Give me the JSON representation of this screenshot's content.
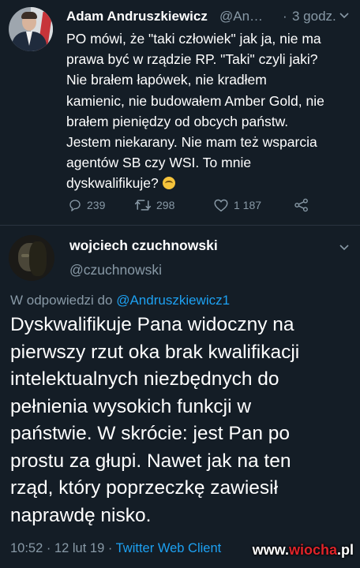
{
  "tweet1": {
    "author_name": "Adam Andruszkiewicz",
    "author_handle": "@An…",
    "separator": "·",
    "time": "3 godz.",
    "text_lines": [
      "PO mówi, że \"taki człowiek\" jak ja, nie ma",
      "prawa być w rządzie RP. \"Taki\" czyli jaki?",
      "Nie brałem łapówek, nie kradłem",
      "kamienic, nie budowałem Amber Gold, nie",
      "brałem pieniędzy od obcych państw.",
      "Jestem niekarany. Nie mam też wsparcia",
      "agentów SB czy WSI. To mnie",
      "dyskwalifikuje?"
    ],
    "emoji": "upside-down-face-emoji",
    "replies": "239",
    "retweets": "298",
    "likes": "1 187"
  },
  "tweet2": {
    "author_name": "wojciech czuchnowski",
    "author_handle": "@czuchnowski",
    "reply_prefix": "W odpowiedzi do",
    "reply_mention": "@Andruszkiewicz1",
    "text_lines": [
      "Dyskwalifikuje Pana widoczny na",
      "pierwszy rzut oka  brak kwalifikacji",
      "intelektualnych niezbędnych do",
      "pełnienia wysokich funkcji w",
      "państwie. W skrócie: jest Pan po",
      "prostu za głupi. Nawet jak na ten",
      "rząd, który poprzeczkę zawiesił",
      "naprawdę nisko."
    ],
    "meta_time": "10:52 · 12 lut 19 ·",
    "meta_client": "Twitter Web Client"
  },
  "watermark": {
    "prefix": "www.",
    "brand": "wiocha",
    "suffix": ".pl"
  },
  "colors": {
    "background": "#141d26",
    "secondary_text": "#8899a6",
    "link": "#1da1f2",
    "watermark_accent": "#e0242a"
  }
}
